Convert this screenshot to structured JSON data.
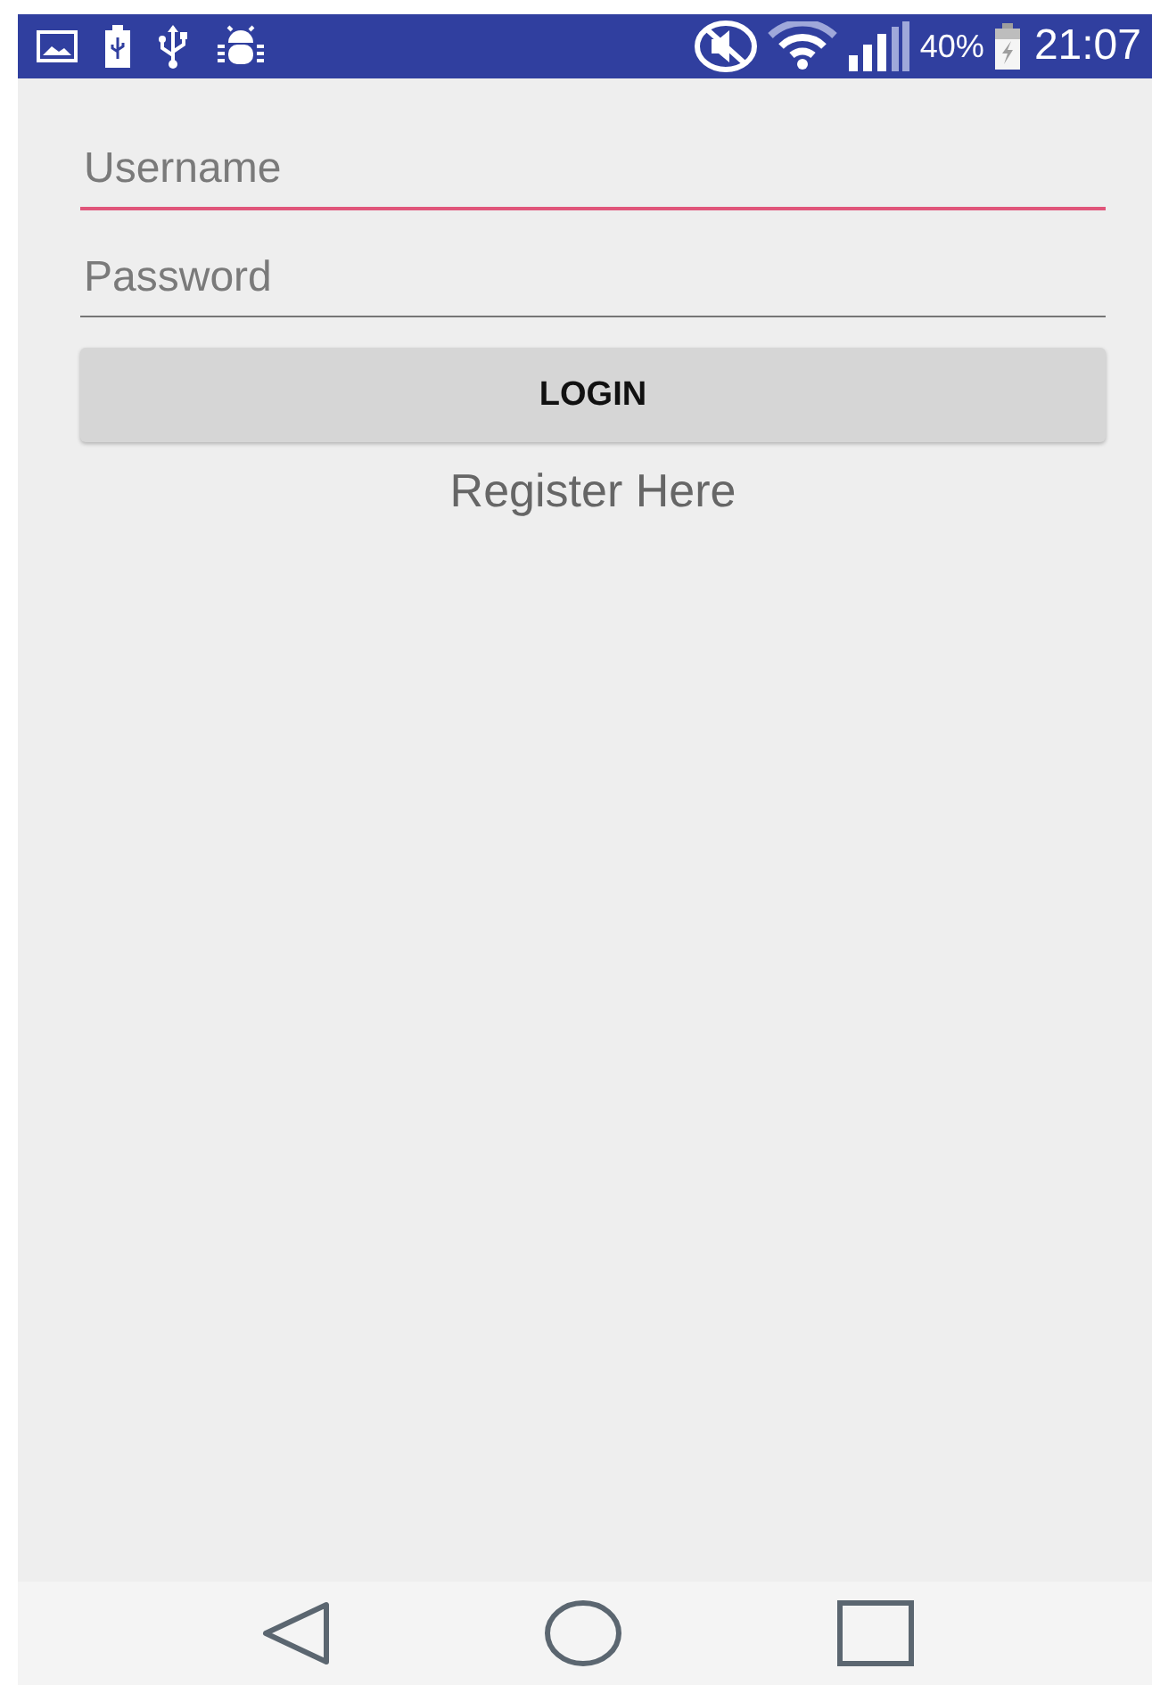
{
  "status_bar": {
    "battery_text": "40%",
    "time": "21:07"
  },
  "fields": [
    {
      "placeholder": "Username",
      "focused": true
    },
    {
      "placeholder": "Password",
      "focused": false
    }
  ],
  "login_button": {
    "label": "LOGIN"
  },
  "register_link": {
    "label": "Register Here"
  }
}
